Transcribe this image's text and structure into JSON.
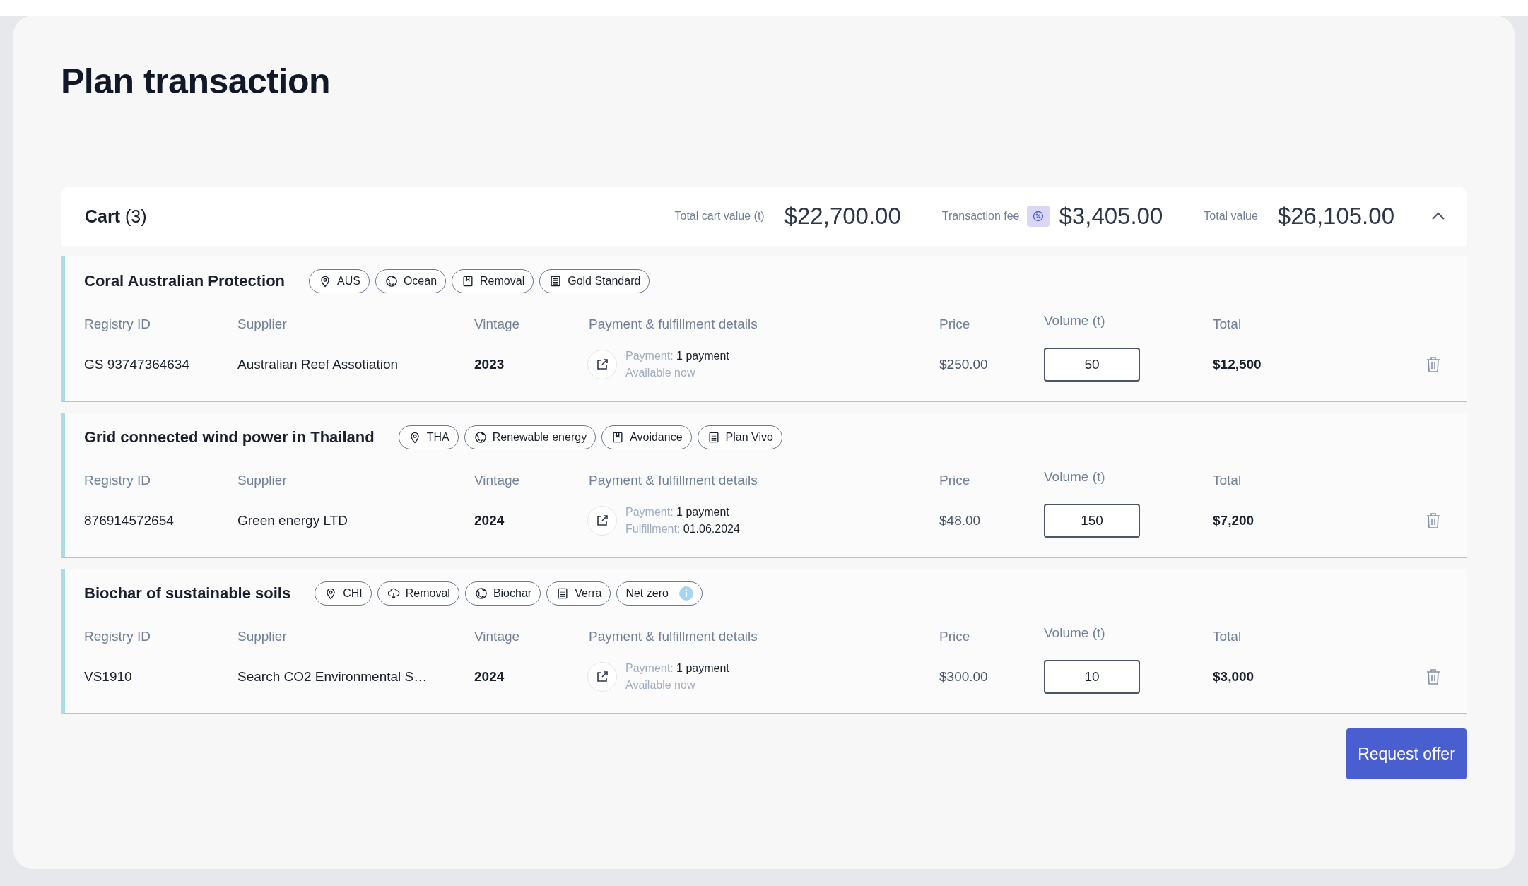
{
  "title": "Plan transaction",
  "cart": {
    "label": "Cart",
    "count": "(3)",
    "summaries": [
      {
        "label": "Total cart value (t)",
        "value": "$22,700.00",
        "kind": "plain"
      },
      {
        "label": "Transaction fee",
        "value": "$3,405.00",
        "kind": "fee"
      },
      {
        "label": "Total value",
        "value": "$26,105.00",
        "kind": "plain"
      }
    ],
    "expanded": true
  },
  "items": [
    {
      "name": "Coral Australian Protection",
      "columns": [
        "Registry ID",
        "Supplier",
        "Vintage",
        "Payment & fulfillment details",
        "Price",
        "Volume (t)",
        "Total"
      ],
      "tags": [
        {
          "label": "AUS",
          "kind": "location"
        },
        {
          "label": "Ocean",
          "kind": "sector"
        },
        {
          "label": "Removal",
          "kind": "bookmark"
        },
        {
          "label": "Gold Standard",
          "kind": "standard"
        }
      ],
      "registry_id": "GS 93747364634",
      "supplier": "Australian Reef Assotiation",
      "vintage": "2023",
      "details": [
        {
          "label": "Payment:",
          "value": "1 payment"
        },
        {
          "label": "Available now"
        }
      ],
      "price": "$250.00",
      "volume": "50",
      "total": "$12,500"
    },
    {
      "name": "Grid connected wind power in Thailand",
      "columns": [
        "Registry ID",
        "Supplier",
        "Vintage",
        "Payment & fulfillment details",
        "Price",
        "Volume (t)",
        "Total"
      ],
      "tags": [
        {
          "label": "THA",
          "kind": "location"
        },
        {
          "label": "Renewable energy",
          "kind": "sector"
        },
        {
          "label": "Avoidance",
          "kind": "bookmark"
        },
        {
          "label": "Plan Vivo",
          "kind": "standard"
        }
      ],
      "registry_id": "876914572654",
      "supplier": "Green energy LTD",
      "vintage": "2024",
      "details": [
        {
          "label": "Payment:",
          "value": "1 payment"
        },
        {
          "label": "Fulfillment:",
          "value": "01.06.2024"
        }
      ],
      "price": "$48.00",
      "volume": "150",
      "total": "$7,200"
    },
    {
      "name": "Biochar of sustainable soils",
      "columns": [
        "Registry ID",
        "Supplier",
        "Vintage",
        "Payment & fulfillment details",
        "Price",
        "Volume (t)",
        "Total"
      ],
      "tags": [
        {
          "label": "CHI",
          "kind": "location"
        },
        {
          "label": "Removal",
          "kind": "cloud"
        },
        {
          "label": "Biochar",
          "kind": "sector"
        },
        {
          "label": "Verra",
          "kind": "standard"
        },
        {
          "label": "Net zero",
          "kind": "info"
        }
      ],
      "registry_id": "VS1910",
      "supplier": "Search CO2 Environmental S…",
      "vintage": "2024",
      "details": [
        {
          "label": "Payment:",
          "value": "1 payment"
        },
        {
          "label": "Available now"
        }
      ],
      "price": "$300.00",
      "volume": "10",
      "total": "$3,000"
    }
  ],
  "button": "Request offer"
}
